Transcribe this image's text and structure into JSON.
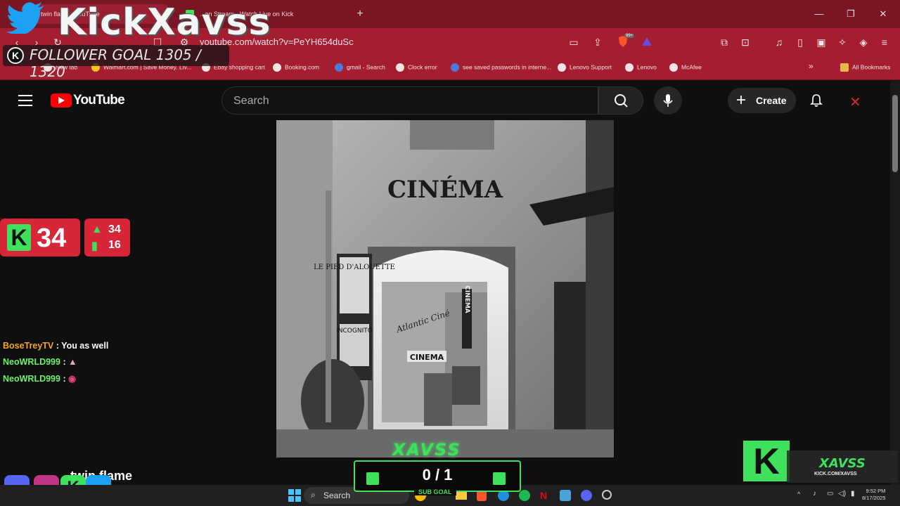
{
  "browser": {
    "tabs": [
      {
        "title": "twin flame - YouTube"
      },
      {
        "title": "...on Stream - Watch Live on Kick"
      }
    ],
    "url": "youtube.com/watch?v=PeYH654duSc",
    "bookmarks": [
      "New tab",
      "Walmart.com | Save Money. Liv...",
      "Ebay shopping cart",
      "Booking.com",
      "gmail - Search",
      "Clock error",
      "see saved passwords in interne...",
      "Lenovo Support",
      "Lenovo",
      "McAfee"
    ],
    "all_bookmarks": "All Bookmarks",
    "badge": "99+"
  },
  "youtube": {
    "logo": "YouTube",
    "search_placeholder": "Search",
    "create_label": "Create",
    "video_title": "twin flame"
  },
  "video_content": {
    "sign_main": "CINÉMA",
    "shop_sign": "LE PIED D'ALOUETTE",
    "incognito": "INCOGNITO",
    "atlantic": "Atlantic Ciné",
    "cinema_small": "CINEMA",
    "cinema_vertical": "CINEMA"
  },
  "overlay": {
    "channel_title": "KickXavss",
    "follower_goal": "FOLLOWER GOAL 1305 / 1320",
    "viewers": "34",
    "stat_up": "34",
    "stat_chart": "16",
    "chat": [
      {
        "user": "BoseTreyTV",
        "message": "You as well",
        "color": "#f5a623"
      },
      {
        "user": "NeoWRLD999",
        "message": "",
        "color": "#6cf26a"
      },
      {
        "user": "NeoWRLD999",
        "message": "",
        "color": "#6cf26a"
      }
    ],
    "sub_goal_count": "0 / 1",
    "sub_goal_label": "SUB GOAL",
    "xavss_logo": "XAVSS",
    "brand_name": "XAVSS",
    "brand_url": "KICK.COM/XAVSS"
  },
  "taskbar": {
    "search": "Search",
    "time": "9:52 PM",
    "date": "8/17/2025"
  },
  "colors": {
    "browser_accent": "#a51d30",
    "kick_green": "#3ee05c",
    "youtube_red": "#ff0000"
  }
}
